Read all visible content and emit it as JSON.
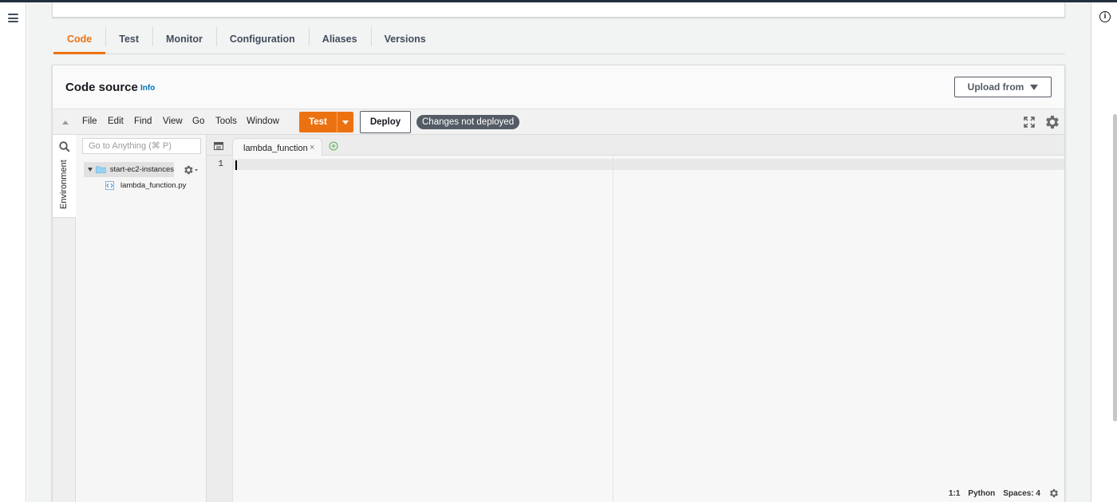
{
  "tabs": [
    "Code",
    "Test",
    "Monitor",
    "Configuration",
    "Aliases",
    "Versions"
  ],
  "active_tab": "Code",
  "code_source": {
    "title": "Code source",
    "info_link": "Info",
    "upload_button": "Upload from"
  },
  "ide": {
    "menu": [
      "File",
      "Edit",
      "Find",
      "View",
      "Go",
      "Tools",
      "Window"
    ],
    "test_button": "Test",
    "deploy_button": "Deploy",
    "status_badge": "Changes not deployed",
    "environment_tab": "Environment",
    "goto_placeholder": "Go to Anything (⌘ P)",
    "folder": "start-ec2-instances",
    "file": "lambda_function.py",
    "open_tab": "lambda_function",
    "tab_close": "×",
    "line_number": "1",
    "status": {
      "position": "1:1",
      "language": "Python",
      "spaces": "Spaces: 4"
    }
  },
  "colors": {
    "accent": "#ec7211",
    "link": "#0073bb",
    "badge": "#545b64",
    "topbar": "#232f3e"
  },
  "icons": [
    "menu-icon",
    "info-icon",
    "search-icon",
    "folder-icon",
    "gear-icon",
    "fullscreen-icon",
    "python-file-icon",
    "add-tab-icon",
    "tab-list-icon"
  ]
}
